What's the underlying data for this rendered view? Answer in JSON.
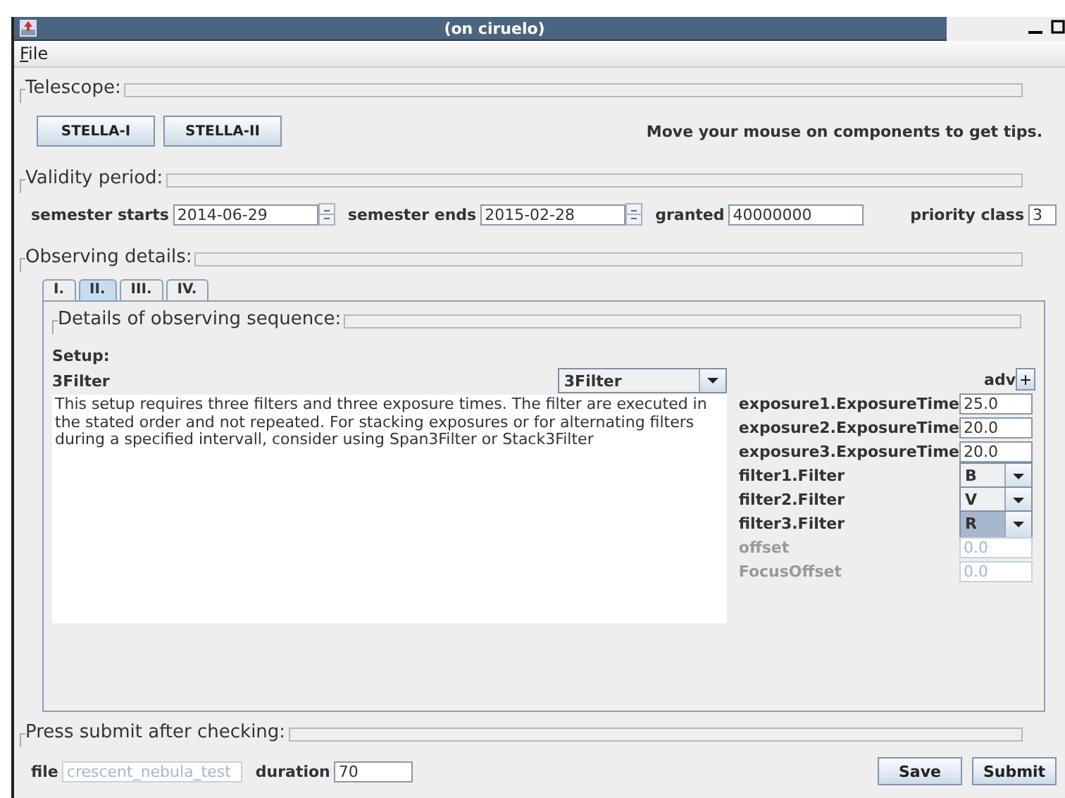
{
  "window": {
    "title": "(on ciruelo)"
  },
  "menu": [
    {
      "label": "File"
    }
  ],
  "telescope": {
    "title": "Telescope:",
    "buttons": [
      "STELLA-I",
      "STELLA-II"
    ],
    "hint": "Move your mouse on components to get tips."
  },
  "validity": {
    "title": "Validity period:",
    "fields": [
      {
        "kind": "spinner",
        "label": "semester starts",
        "value": "2014-06-29"
      },
      {
        "kind": "spinner",
        "label": "semester ends",
        "value": "2015-02-28"
      },
      {
        "kind": "text",
        "label": "granted",
        "value": "40000000"
      },
      {
        "kind": "small",
        "label": "priority class",
        "value": "3"
      }
    ]
  },
  "observing": {
    "title": "Observing details:",
    "tabs": [
      {
        "label": "I.",
        "selected": false
      },
      {
        "label": "II.",
        "selected": true
      },
      {
        "label": "III.",
        "selected": false
      },
      {
        "label": "IV.",
        "selected": false
      }
    ],
    "sequence": {
      "title": "Details of observing sequence:",
      "setup_label": "Setup:",
      "setup_name": "3Filter",
      "setup_combo": "3Filter",
      "description": "This setup requires three filters and three exposure times. The filter are executed in the stated order and not repeated. For stacking exposures or for alternating filters during a specified intervall, consider using Span3Filter or Stack3Filter",
      "adv_label": "adv",
      "adv_button": "+",
      "params": [
        {
          "kind": "text",
          "label": "exposure1.ExposureTime",
          "value": "25.0",
          "disabled": false
        },
        {
          "kind": "text",
          "label": "exposure2.ExposureTime",
          "value": "20.0",
          "disabled": false
        },
        {
          "kind": "text",
          "label": "exposure3.ExposureTime",
          "value": "20.0",
          "disabled": false
        },
        {
          "kind": "combo",
          "label": "filter1.Filter",
          "value": "B",
          "selected": false
        },
        {
          "kind": "combo",
          "label": "filter2.Filter",
          "value": "V",
          "selected": false
        },
        {
          "kind": "combo",
          "label": "filter3.Filter",
          "value": "R",
          "selected": true
        },
        {
          "kind": "text",
          "label": "offset",
          "value": "0.0",
          "disabled": true
        },
        {
          "kind": "text",
          "label": "FocusOffset",
          "value": "0.0",
          "disabled": true
        }
      ]
    }
  },
  "submit": {
    "title": "Press submit after checking:",
    "fields": [
      {
        "label": "file",
        "value": "crescent_nebula_test",
        "disabled": true
      },
      {
        "label": "duration",
        "value": "70",
        "disabled": false
      }
    ],
    "buttons": [
      "Save",
      "Submit"
    ]
  }
}
